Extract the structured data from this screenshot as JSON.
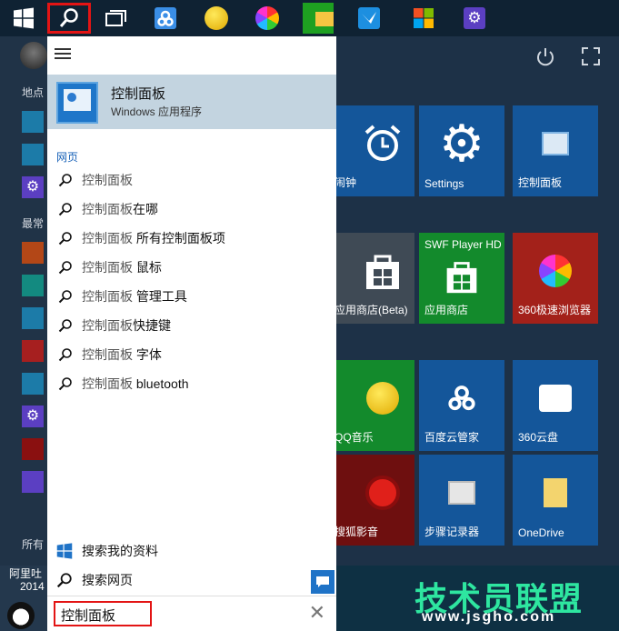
{
  "taskbar": {
    "icons": [
      "windows-start-icon",
      "search-icon",
      "task-view-icon",
      "baidu-cloud-icon",
      "qq-music-icon",
      "browser-360-icon",
      "file-explorer-icon",
      "bird-icon",
      "store-icon",
      "settings-icon"
    ]
  },
  "rail": {
    "places_label": "地点",
    "recent_label": "最常",
    "all_label": "所有",
    "user_partial": "阿里吐",
    "year_partial": "2014"
  },
  "panel": {
    "best_match": {
      "title": "控制面板",
      "subtitle": "Windows 应用程序"
    },
    "web_header": "网页",
    "suggestions": [
      {
        "prefix": "控制面板",
        "suffix": ""
      },
      {
        "prefix": "控制面板",
        "suffix": "在哪"
      },
      {
        "prefix": "控制面板",
        "suffix": " 所有控制面板项"
      },
      {
        "prefix": "控制面板",
        "suffix": " 鼠标"
      },
      {
        "prefix": "控制面板",
        "suffix": " 管理工具"
      },
      {
        "prefix": "控制面板",
        "suffix": "快捷键"
      },
      {
        "prefix": "控制面板",
        "suffix": " 字体"
      },
      {
        "prefix": "控制面板",
        "suffix": " bluetooth"
      }
    ],
    "search_my_stuff": "搜索我的资料",
    "search_web": "搜索网页"
  },
  "search_box": {
    "value": "控制面板",
    "clear": "✕"
  },
  "tiles": {
    "alarm": "闹钟",
    "settings": "Settings",
    "control_panel": "控制面板",
    "store_beta": "应用商店(Beta)",
    "swf_top": "SWF Player HD",
    "store": "应用商店",
    "browser360": "360极速浏览器",
    "qq_music": "QQ音乐",
    "baidu_cloud": "百度云管家",
    "cloud360": "360云盘",
    "sohu_video": "搜狐影音",
    "steps_recorder": "步骤记录器",
    "onedrive": "OneDrive"
  },
  "watermark": {
    "title": "技术员联盟",
    "url": "www.jsgho.com"
  },
  "colors": {
    "accent": "#1f73c7",
    "highlight_red": "#e31414",
    "tile_blue": "#14569a",
    "tile_green": "#138a2c",
    "tile_red": "#a3211a"
  }
}
